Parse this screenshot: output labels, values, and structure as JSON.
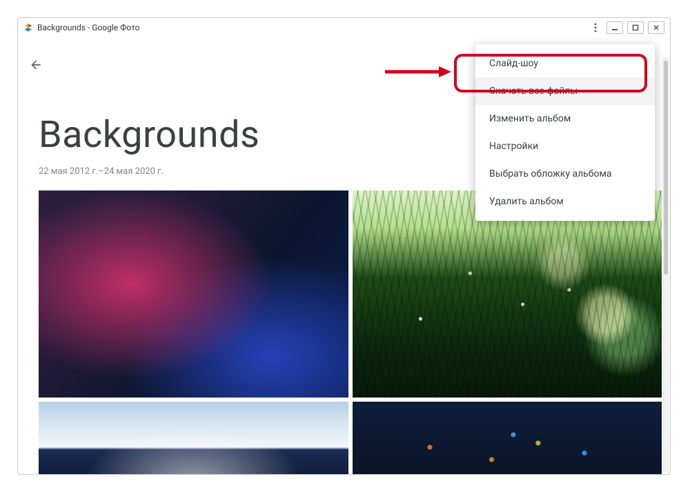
{
  "window": {
    "title": "Backgrounds - Google Фото"
  },
  "album": {
    "title": "Backgrounds",
    "date_range": "22 мая 2012 г.–24 мая 2020 г."
  },
  "menu": {
    "items": [
      {
        "label": "Слайд-шоу"
      },
      {
        "label": "Скачать все файлы"
      },
      {
        "label": "Изменить альбом"
      },
      {
        "label": "Настройки"
      },
      {
        "label": "Выбрать обложку альбома"
      },
      {
        "label": "Удалить альбом"
      }
    ]
  }
}
